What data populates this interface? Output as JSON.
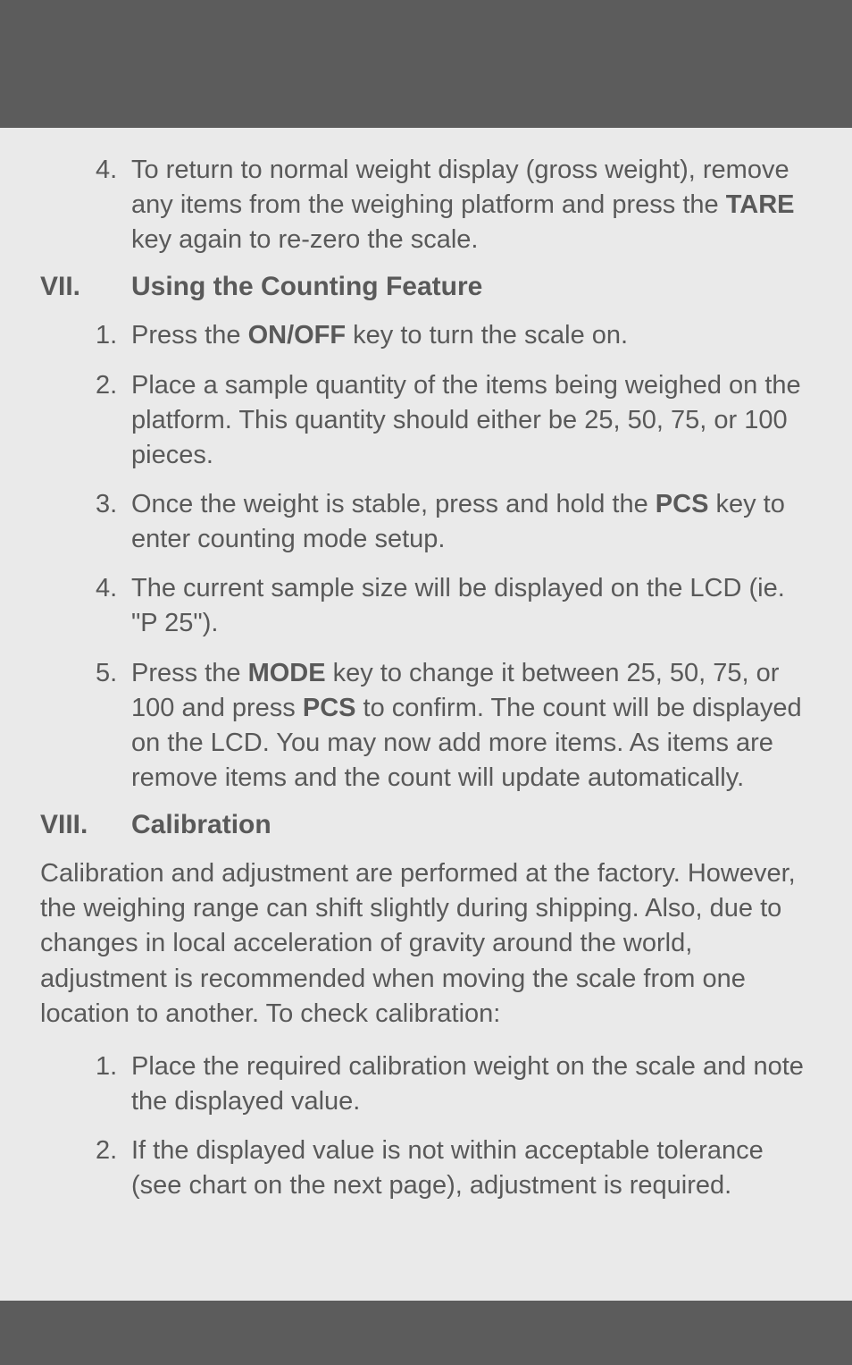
{
  "continuing_list": {
    "item4": {
      "num": "4.",
      "text_before": "To return to normal weight display (gross weight), remove any items from the weighing platform and press the ",
      "bold": "TARE",
      "text_after": " key again to re-zero the scale."
    }
  },
  "section7": {
    "roman": "VII.",
    "title": "Using the Counting Feature",
    "items": {
      "i1": {
        "num": "1.",
        "t1": "Press the ",
        "b1": "ON/OFF",
        "t2": " key to turn the scale on."
      },
      "i2": {
        "num": "2.",
        "text": "Place a sample quantity of the items being weighed on the platform. This quantity should either be 25, 50, 75, or 100 pieces."
      },
      "i3": {
        "num": "3.",
        "t1": "Once the weight is stable, press and hold the ",
        "b1": "PCS",
        "t2": " key to enter counting mode setup."
      },
      "i4": {
        "num": "4.",
        "text": "The current sample size will be displayed on the LCD (ie. \"P  25\")."
      },
      "i5": {
        "num": "5.",
        "t1": "Press the ",
        "b1": "MODE",
        "t2": " key to change it between 25, 50, 75, or 100 and press ",
        "b2": "PCS",
        "t3": " to confirm. The count will be displayed on the LCD. You may now add more items. As items are remove items and the count will update automatically."
      }
    }
  },
  "section8": {
    "roman": "VIII.",
    "title": "Calibration",
    "intro": "Calibration and adjustment are performed at the factory. However, the weighing range can shift slightly during shipping. Also, due to changes in local acceleration of gravity around the world, adjustment is recommended when moving the scale from one location to another. To check calibration:",
    "items": {
      "i1": {
        "num": "1.",
        "text": "Place the required calibration weight on the scale and note the displayed value."
      },
      "i2": {
        "num": "2.",
        "text": "If the displayed value is not within acceptable tolerance (see chart on the next page), adjustment is required."
      }
    }
  }
}
